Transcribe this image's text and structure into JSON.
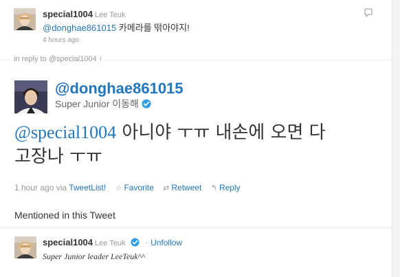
{
  "reply_tweet": {
    "username": "special1004",
    "fullname": "Lee Teuk",
    "mention": "@donghae861015",
    "text": " 카메라를 떢아야지!",
    "time": "4 hours ago",
    "avatar_icon": "user-avatar-photo",
    "favorite_icon": "speech-bubble-icon"
  },
  "in_reply_to": {
    "label": "in reply to @special1004",
    "arrow": "↑"
  },
  "main_tweet": {
    "handle": "@donghae861015",
    "fullname": "Super Junior 이동해",
    "verified_icon": "verified-badge-icon",
    "mention": "@special1004",
    "text_line1": " 아니야 ㅜㅠ 내손에 오면 다",
    "text_line2": "고장나 ㅜㅠ",
    "time": "1 hour ago",
    "via_prefix": "via",
    "client": "TweetList!",
    "actions": {
      "favorite_label": "Favorite",
      "retweet_label": "Retweet",
      "reply_label": "Reply"
    }
  },
  "mentioned": {
    "title": "Mentioned in this Tweet",
    "user": {
      "username": "special1004",
      "fullname": "Lee Teuk",
      "unfollow_label": "Unfollow",
      "bio": "Super Junior leader LeeTeuk^^"
    }
  },
  "colors": {
    "link": "#2276bb",
    "muted": "#999999",
    "text": "#333333",
    "verified": "#2f9ee3"
  }
}
